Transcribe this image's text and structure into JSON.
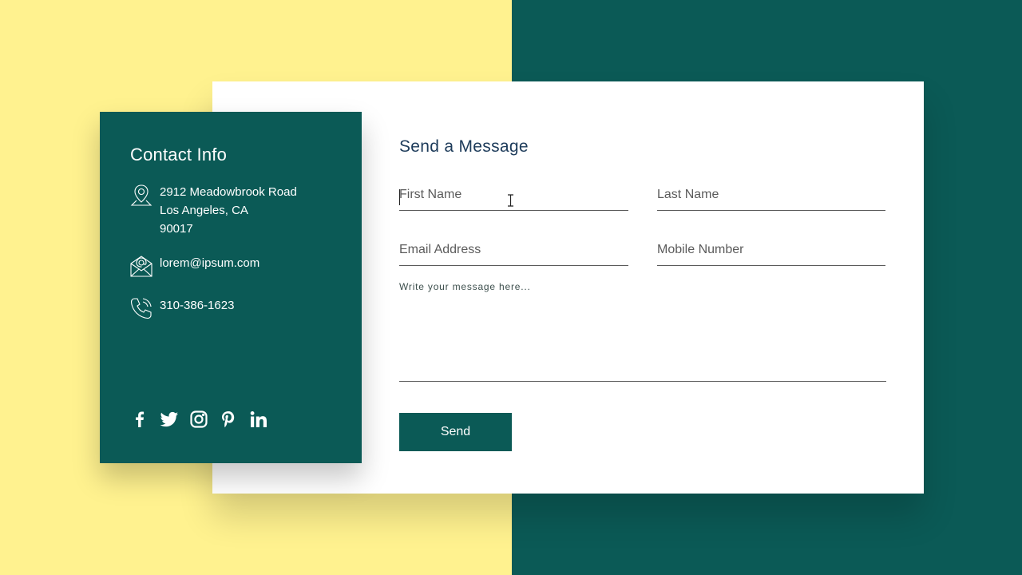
{
  "colors": {
    "yellow_bg": "#fff28f",
    "teal": "#0b5a56",
    "card_white": "#ffffff",
    "title_navy": "#1d3b5a"
  },
  "contact": {
    "title": "Contact Info",
    "address_line1": "2912 Meadowbrook Road",
    "address_line2": "Los Angeles, CA",
    "address_line3": "90017",
    "email": "lorem@ipsum.com",
    "phone": "310-386-1623",
    "icons": {
      "address": "location-pin-icon",
      "email": "envelope-icon",
      "phone": "phone-icon"
    },
    "social": [
      "facebook-icon",
      "twitter-icon",
      "instagram-icon",
      "pinterest-icon",
      "linkedin-icon"
    ]
  },
  "form": {
    "title": "Send a Message",
    "first_name_placeholder": "First Name",
    "last_name_placeholder": "Last Name",
    "email_placeholder": "Email Address",
    "mobile_placeholder": "Mobile Number",
    "message_placeholder": "Write your message here...",
    "send_label": "Send"
  }
}
